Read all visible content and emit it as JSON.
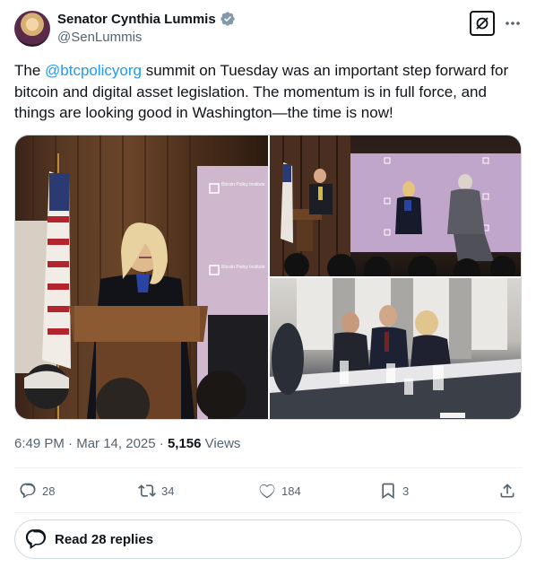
{
  "author": {
    "name": "Senator Cynthia Lummis",
    "handle": "@SenLummis",
    "verified": true,
    "verified_color": "#829aab"
  },
  "tweet": {
    "text_before": "The ",
    "mention": "@btcpolicyorg",
    "text_after": " summit on Tuesday was an important step forward for bitcoin and digital asset legislation. The momentum is in full force, and things are looking good in Washington—the time is now!",
    "link_color": "#1d9bf0"
  },
  "media": {
    "signs": {
      "banner_text": "Bitcoin Policy Institute"
    }
  },
  "meta": {
    "time": "6:49 PM",
    "separator": " · ",
    "date": "Mar 14, 2025",
    "views_count": "5,156",
    "views_label": " Views"
  },
  "actions": {
    "replies": "28",
    "reposts": "34",
    "likes": "184",
    "bookmarks": "3"
  },
  "read_replies": "Read 28 replies"
}
